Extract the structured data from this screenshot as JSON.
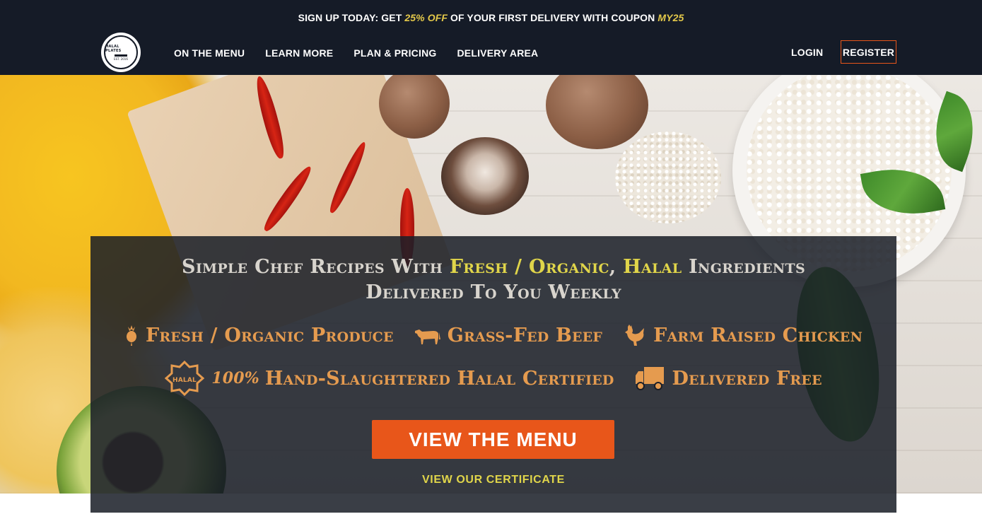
{
  "promo": {
    "prefix": "SIGN UP TODAY: GET ",
    "discount": "25% OFF",
    "middle": " OF YOUR FIRST DELIVERY WITH COUPON ",
    "coupon": "MY25"
  },
  "nav": {
    "logo": {
      "line1": "HALAL PLATES",
      "line2": "EST. 2016"
    },
    "links": [
      "ON THE MENU",
      "LEARN MORE",
      "PLAN & PRICING",
      "DELIVERY AREA"
    ],
    "login": "LOGIN",
    "register": "REGISTER"
  },
  "hero": {
    "headline": {
      "part1": "Simple Chef Recipes With ",
      "fresh": "Fresh",
      "sep": " / ",
      "organic": "Organic",
      "comma": ", ",
      "halal": "Halal",
      "part2": " Ingredients",
      "line2": "Delivered To You Weekly"
    },
    "features": {
      "produce": {
        "icon": "produce-icon",
        "label": "Fresh / Organic Produce"
      },
      "beef": {
        "icon": "cow-icon",
        "label": "Grass-Fed Beef"
      },
      "chicken": {
        "icon": "chicken-icon",
        "label": "Farm Raised Chicken"
      },
      "halal": {
        "icon": "halal-badge-icon",
        "badge": "HALAL",
        "pct": "100%",
        "label": "Hand-Slaughtered Halal Certified"
      },
      "delivery": {
        "icon": "truck-icon",
        "label": "Delivered Free"
      }
    },
    "cta": "VIEW THE MENU",
    "certificate": "VIEW OUR CERTIFICATE"
  },
  "colors": {
    "nav_bg": "#151b27",
    "accent": "#e8561a",
    "highlight": "#e0d54a",
    "feature": "#e59b4f"
  }
}
